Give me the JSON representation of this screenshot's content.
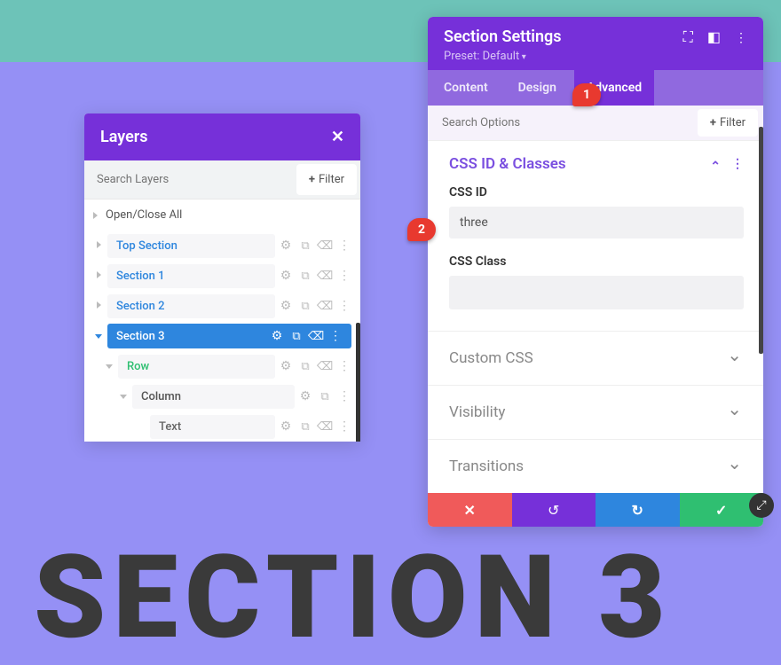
{
  "layers_panel": {
    "title": "Layers",
    "search_placeholder": "Search Layers",
    "filter_label": "Filter",
    "open_close_all": "Open/Close All",
    "items": [
      {
        "label": "Top Section",
        "level": 0,
        "active": false,
        "expanded": false
      },
      {
        "label": "Section 1",
        "level": 0,
        "active": false,
        "expanded": false
      },
      {
        "label": "Section 2",
        "level": 0,
        "active": false,
        "expanded": false
      },
      {
        "label": "Section 3",
        "level": 0,
        "active": true,
        "expanded": true
      },
      {
        "label": "Row",
        "level": 1,
        "active": false,
        "expanded": true,
        "green": true
      },
      {
        "label": "Column",
        "level": 2,
        "active": false,
        "expanded": true
      },
      {
        "label": "Text",
        "level": 3,
        "active": false,
        "expanded": false
      }
    ]
  },
  "settings_panel": {
    "title": "Section Settings",
    "preset": "Preset: Default",
    "tabs": [
      "Content",
      "Design",
      "Advanced"
    ],
    "active_tab": 2,
    "search_placeholder": "Search Options",
    "filter_label": "Filter",
    "group": {
      "title": "CSS ID & Classes",
      "fields": [
        {
          "label": "CSS ID",
          "value": "three"
        },
        {
          "label": "CSS Class",
          "value": ""
        }
      ]
    },
    "collapse_groups": [
      "Custom CSS",
      "Visibility",
      "Transitions"
    ]
  },
  "markers": {
    "m1": "1",
    "m2": "2"
  },
  "big_text": "SECTION 3"
}
